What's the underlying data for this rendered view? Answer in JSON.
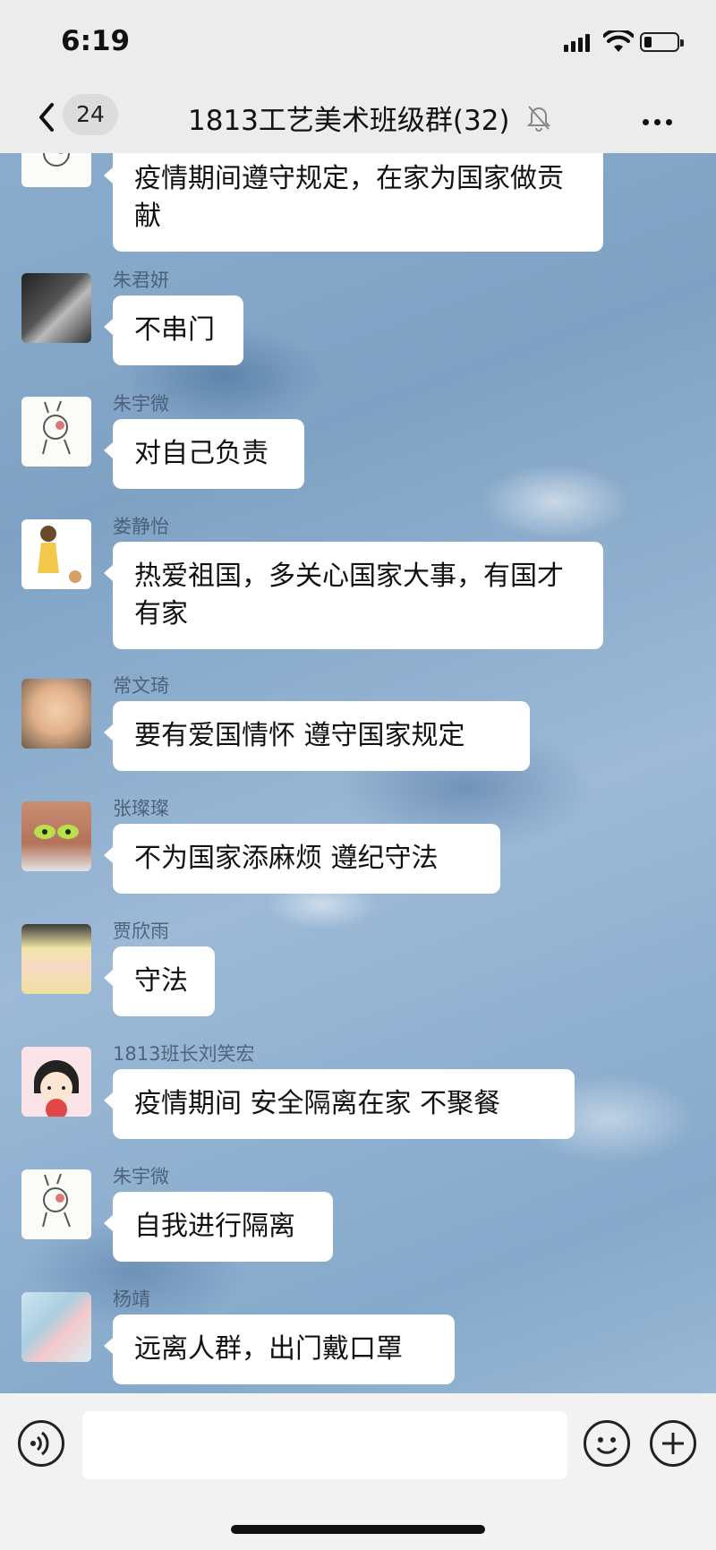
{
  "status_bar": {
    "time": "6:19"
  },
  "header": {
    "back_badge": "24",
    "title": "1813工艺美术班级群(32)"
  },
  "messages": [
    {
      "name": "",
      "text": "疫情期间遵守规定，在家为国家做贡献",
      "avatar": "rabbit-drawing"
    },
    {
      "name": "朱君妍",
      "text": "不串门",
      "avatar": "photo-girl"
    },
    {
      "name": "朱宇微",
      "text": "对自己负责",
      "avatar": "rabbit-drawing"
    },
    {
      "name": "娄静怡",
      "text": "热爱祖国，多关心国家大事，有国才有家",
      "avatar": "cartoon-girl-dog"
    },
    {
      "name": "常文琦",
      "text": "要有爱国情怀 遵守国家规定",
      "avatar": "baby-photo"
    },
    {
      "name": "张璨璨",
      "text": "不为国家添麻烦  遵纪守法",
      "avatar": "alien-mask-photo"
    },
    {
      "name": "贾欣雨",
      "text": "守法",
      "avatar": "blonde-girl-photo"
    },
    {
      "name": "1813班长刘笑宏",
      "text": "疫情期间  安全隔离在家  不聚餐",
      "avatar": "cartoon-maruko"
    },
    {
      "name": "朱宇微",
      "text": "自我进行隔离",
      "avatar": "rabbit-drawing"
    },
    {
      "name": "杨靖",
      "text": "远离人群，出门戴口罩",
      "avatar": "pastel-illustration"
    }
  ],
  "input_bar": {
    "placeholder": ""
  },
  "colors": {
    "bubble": "#ffffff",
    "bar": "#ececec",
    "water": "#8fb0cf"
  }
}
